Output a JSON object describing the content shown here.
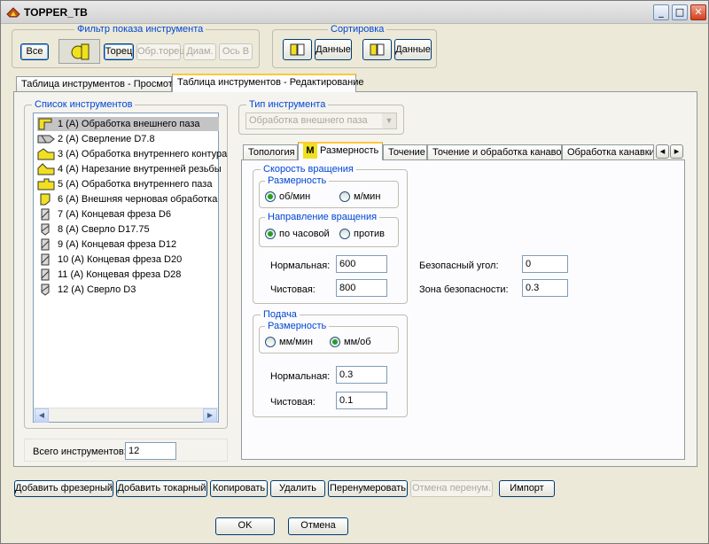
{
  "window": {
    "title": "TOPPER_TB"
  },
  "title_buttons": {
    "minimize": "_",
    "maximize": "□",
    "close": "✕"
  },
  "filter": {
    "label": "Фильтр показа инструмента",
    "all": "Все",
    "face": "Торец",
    "back_face": "Обр.торец",
    "diameter": "Диам.",
    "axis_b": "Ось B"
  },
  "sort": {
    "label": "Сортировка",
    "data1": "Данные",
    "data2": "Данные"
  },
  "outer_tabs": [
    "Таблица инструментов - Просмотр",
    "Таблица инструментов - Редактирование"
  ],
  "tool_list": {
    "label": "Список инструментов",
    "items": [
      {
        "text": "1 (A)  Обработка внешнего паза",
        "icon": "groove-outer-icon"
      },
      {
        "text": "2 (A)  Сверление  D7.8",
        "icon": "drill-icon"
      },
      {
        "text": "3 (A)  Обработка внутреннего контура",
        "icon": "internal-contour-icon"
      },
      {
        "text": "4 (A)  Нарезание внутренней резьбы",
        "icon": "internal-thread-icon"
      },
      {
        "text": "5 (A)  Обработка внутреннего паза",
        "icon": "groove-inner-icon"
      },
      {
        "text": "6 (A)  Внешняя черновая обработка",
        "icon": "rough-outer-icon"
      },
      {
        "text": "7 (A)  Концевая фреза  D6",
        "icon": "end-mill-icon"
      },
      {
        "text": "8 (A)  Сверло  D17.75",
        "icon": "drill-bit-icon"
      },
      {
        "text": "9 (A)  Концевая фреза  D12",
        "icon": "end-mill-icon"
      },
      {
        "text": "10 (A)  Концевая фреза  D20",
        "icon": "end-mill-icon"
      },
      {
        "text": "11 (A)  Концевая фреза  D28",
        "icon": "end-mill-icon"
      },
      {
        "text": "12 (A)  Сверло  D3",
        "icon": "drill-bit-icon"
      }
    ]
  },
  "total": {
    "label": "Всего инструментов:",
    "value": "12"
  },
  "tool_type": {
    "label": "Тип инструмента",
    "value": "Обработка внешнего паза"
  },
  "inner_tabs": [
    "Топология",
    "Размерность",
    "Точение",
    "Точение и обработка канавок",
    "Обработка канавки"
  ],
  "inner_tab_nav": {
    "left": "◂",
    "right": "▸"
  },
  "speed": {
    "label": "Скорость вращения",
    "dim_label": "Размерность",
    "rpm": "об/мин",
    "mpm": "м/мин",
    "dir_label": "Направление вращения",
    "cw": "по часовой",
    "ccw": "против",
    "normal_label": "Нормальная:",
    "normal_value": "600",
    "finish_label": "Чистовая:",
    "finish_value": "800"
  },
  "safety": {
    "angle_label": "Безопасный угол:",
    "angle_value": "0",
    "zone_label": "Зона безопасности:",
    "zone_value": "0.3"
  },
  "feed": {
    "label": "Подача",
    "dim_label": "Размерность",
    "mm_min": "мм/мин",
    "mm_rev": "мм/об",
    "normal_label": "Нормальная:",
    "normal_value": "0.3",
    "finish_label": "Чистовая:",
    "finish_value": "0.1"
  },
  "actions": {
    "add_mill": "Добавить фрезерный",
    "add_turn": "Добавить токарный",
    "copy": "Копировать",
    "delete": "Удалить",
    "renumber": "Перенумеровать",
    "undo_renumber": "Отмена перенум.",
    "import": "Импорт"
  },
  "dialog": {
    "ok": "OK",
    "cancel": "Отмена"
  }
}
